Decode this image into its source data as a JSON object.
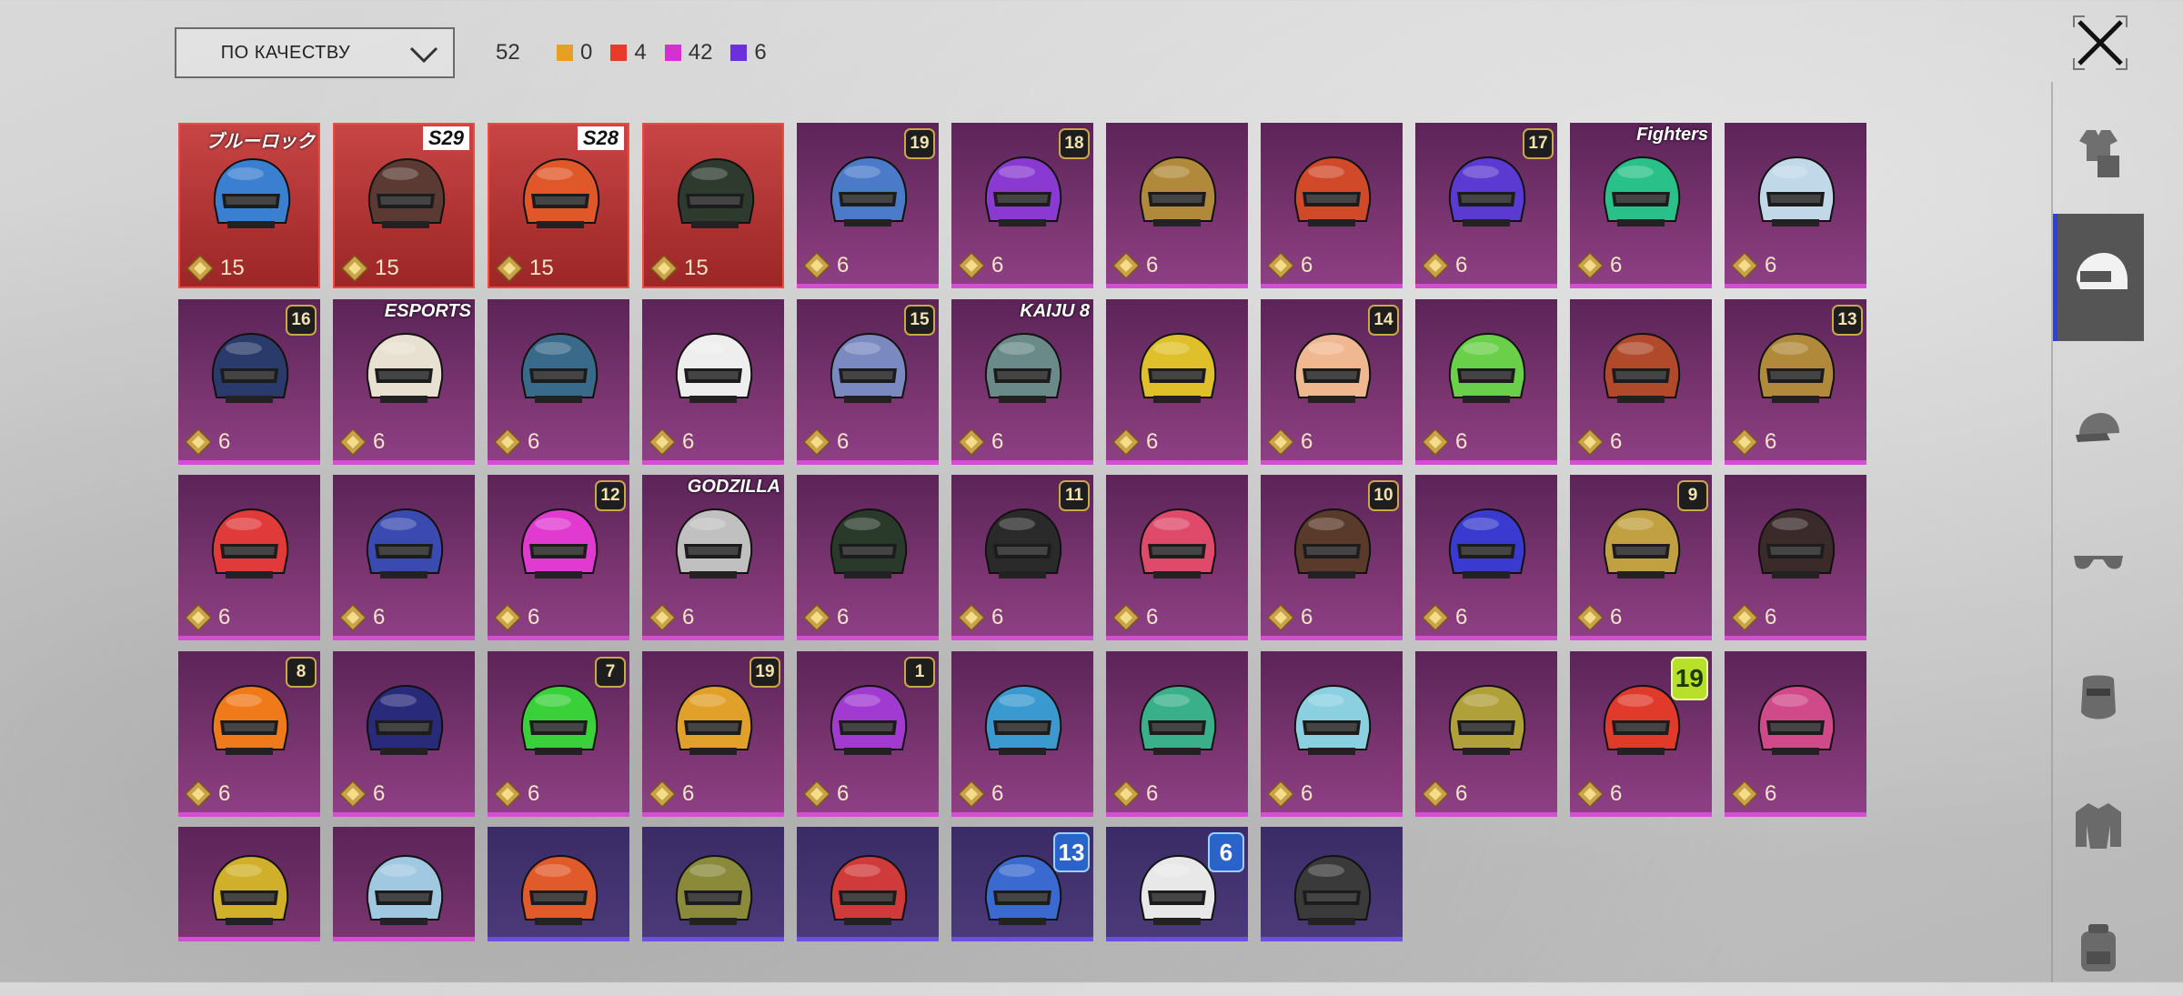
{
  "sort": {
    "label": "ПО КАЧЕСТВУ"
  },
  "total_count": "52",
  "legend": [
    {
      "color": "#e6a020",
      "count": "0"
    },
    {
      "color": "#e83a2a",
      "count": "4"
    },
    {
      "color": "#d62fd0",
      "count": "42"
    },
    {
      "color": "#6b2fe0",
      "count": "6"
    }
  ],
  "sidebar_tabs": [
    {
      "icon": "outfit-icon",
      "active": false
    },
    {
      "icon": "helmet-icon",
      "active": true
    },
    {
      "icon": "cap-icon",
      "active": false
    },
    {
      "icon": "glasses-icon",
      "active": false
    },
    {
      "icon": "mask-icon",
      "active": false
    },
    {
      "icon": "jacket-icon",
      "active": false
    },
    {
      "icon": "backpack-icon",
      "active": false
    }
  ],
  "items": [
    {
      "rarity": "red",
      "price": "15",
      "tag": "ブルーロック",
      "hue": "#3a7fd0"
    },
    {
      "rarity": "red",
      "price": "15",
      "tag": "S29",
      "hue": "#5a3a32"
    },
    {
      "rarity": "red",
      "price": "15",
      "tag": "S28",
      "hue": "#e0582a"
    },
    {
      "rarity": "red",
      "price": "15",
      "hue": "#2f3a2f"
    },
    {
      "rarity": "purple",
      "price": "6",
      "badge": "19",
      "hue": "#4a7ac8"
    },
    {
      "rarity": "purple",
      "price": "6",
      "badge": "18",
      "hue": "#8a3ad0"
    },
    {
      "rarity": "purple",
      "price": "6",
      "hue": "#b08a3a"
    },
    {
      "rarity": "purple",
      "price": "6",
      "hue": "#d04a2a"
    },
    {
      "rarity": "purple",
      "price": "6",
      "badge": "17",
      "hue": "#5a3ad0"
    },
    {
      "rarity": "purple",
      "price": "6",
      "tag": "Fighters",
      "hue": "#2ac08a"
    },
    {
      "rarity": "purple",
      "price": "6",
      "hue": "#c0d8e8"
    },
    {
      "rarity": "purple",
      "price": "6",
      "badge": "16",
      "hue": "#2a3a6a"
    },
    {
      "rarity": "purple",
      "price": "6",
      "tag": "ESPORTS",
      "hue": "#e8e0d0"
    },
    {
      "rarity": "purple",
      "price": "6",
      "hue": "#3a6a8a"
    },
    {
      "rarity": "purple",
      "price": "6",
      "hue": "#eeeeee"
    },
    {
      "rarity": "purple",
      "price": "6",
      "badge": "15",
      "hue": "#7a8ac0"
    },
    {
      "rarity": "purple",
      "price": "6",
      "tag": "KAIJU 8",
      "hue": "#6a8a8a"
    },
    {
      "rarity": "purple",
      "price": "6",
      "hue": "#e0c02a"
    },
    {
      "rarity": "purple",
      "price": "6",
      "badge": "14",
      "hue": "#f0b890"
    },
    {
      "rarity": "purple",
      "price": "6",
      "hue": "#6ad04a"
    },
    {
      "rarity": "purple",
      "price": "6",
      "hue": "#b04a2a"
    },
    {
      "rarity": "purple",
      "price": "6",
      "badge": "13",
      "hue": "#b08a3a"
    },
    {
      "rarity": "purple",
      "price": "6",
      "hue": "#e03a3a"
    },
    {
      "rarity": "purple",
      "price": "6",
      "hue": "#3a4ab0"
    },
    {
      "rarity": "purple",
      "price": "6",
      "badge": "12",
      "hue": "#e03ad0"
    },
    {
      "rarity": "purple",
      "price": "6",
      "tag": "GODZILLA",
      "hue": "#c0c0c0"
    },
    {
      "rarity": "purple",
      "price": "6",
      "hue": "#2a3a2a"
    },
    {
      "rarity": "purple",
      "price": "6",
      "badge": "11",
      "hue": "#2a2a2a"
    },
    {
      "rarity": "purple",
      "price": "6",
      "hue": "#e04a6a"
    },
    {
      "rarity": "purple",
      "price": "6",
      "badge": "10",
      "hue": "#5a3a2a"
    },
    {
      "rarity": "purple",
      "price": "6",
      "hue": "#3a3ad0"
    },
    {
      "rarity": "purple",
      "price": "6",
      "badge": "9",
      "hue": "#c0a040"
    },
    {
      "rarity": "purple",
      "price": "6",
      "hue": "#3a2a2a"
    },
    {
      "rarity": "purple",
      "price": "6",
      "badge": "8",
      "hue": "#f07a1a"
    },
    {
      "rarity": "purple",
      "price": "6",
      "hue": "#2a2a7a"
    },
    {
      "rarity": "purple",
      "price": "6",
      "badge": "7",
      "hue": "#3ad03a"
    },
    {
      "rarity": "purple",
      "price": "6",
      "badge": "19",
      "hue": "#e0a02a"
    },
    {
      "rarity": "purple",
      "price": "6",
      "badge": "1",
      "hue": "#a03ad0"
    },
    {
      "rarity": "purple",
      "price": "6",
      "hue": "#3a9ad0"
    },
    {
      "rarity": "purple",
      "price": "6",
      "hue": "#3ab08a"
    },
    {
      "rarity": "purple",
      "price": "6",
      "hue": "#8ad0e0"
    },
    {
      "rarity": "purple",
      "price": "6",
      "hue": "#b0a03a"
    },
    {
      "rarity": "purple",
      "price": "6",
      "badge": "19",
      "badge_style": "lime",
      "hue": "#e03a2a"
    },
    {
      "rarity": "purple",
      "price": "6",
      "hue": "#d04a8a"
    },
    {
      "rarity": "purple-short",
      "hue": "#d0b02a"
    },
    {
      "rarity": "purple-short",
      "hue": "#a0c8e0"
    },
    {
      "rarity": "violet",
      "hue": "#e05a2a"
    },
    {
      "rarity": "violet",
      "hue": "#8a8a3a"
    },
    {
      "rarity": "violet",
      "hue": "#d03a3a"
    },
    {
      "rarity": "violet",
      "badge": "13",
      "badge_style": "big",
      "hue": "#3a6ad0"
    },
    {
      "rarity": "violet",
      "badge": "6",
      "badge_style": "big",
      "hue": "#e8e8e8"
    },
    {
      "rarity": "violet",
      "hue": "#3a3a3a"
    }
  ]
}
